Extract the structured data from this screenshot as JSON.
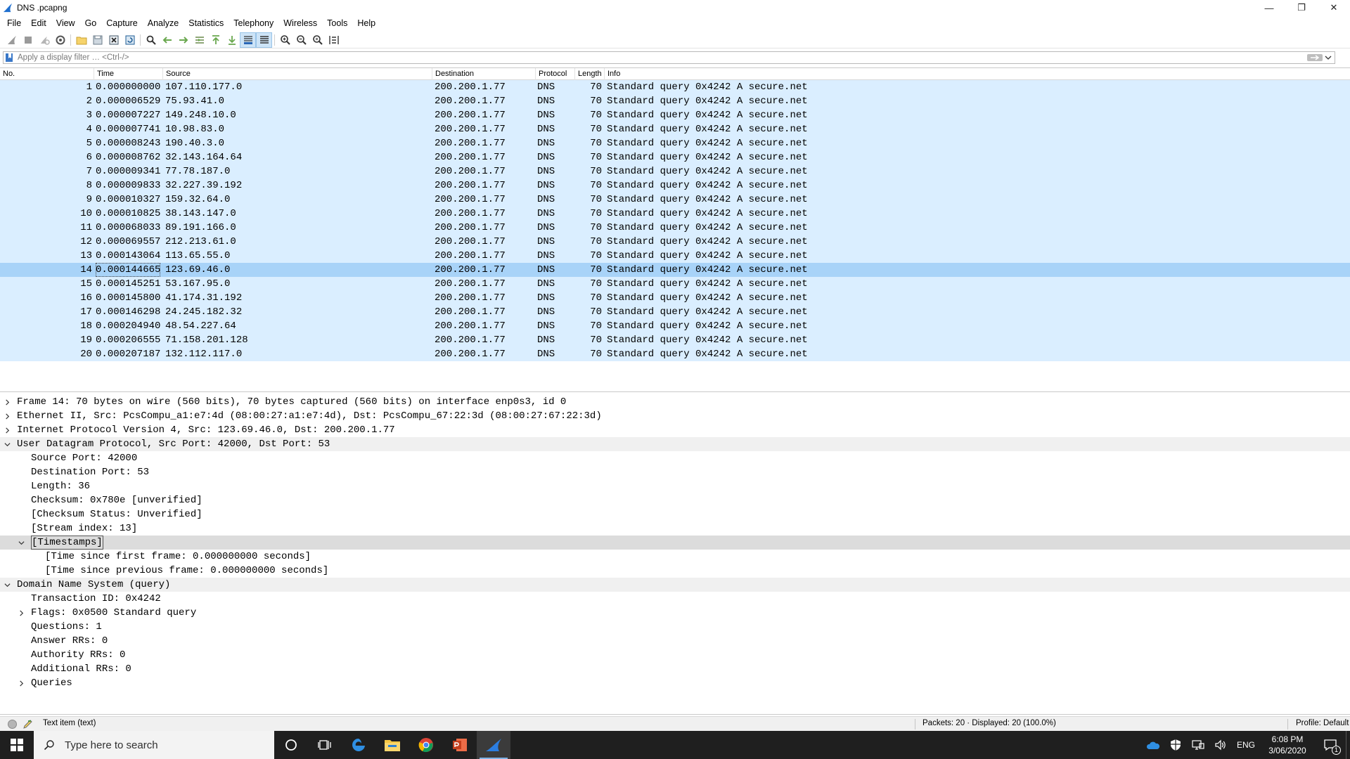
{
  "window": {
    "title": "DNS .pcapng",
    "controls": {
      "minimize": "—",
      "restore": "❐",
      "close": "✕"
    }
  },
  "menu": [
    "File",
    "Edit",
    "View",
    "Go",
    "Capture",
    "Analyze",
    "Statistics",
    "Telephony",
    "Wireless",
    "Tools",
    "Help"
  ],
  "filter": {
    "placeholder": "Apply a display filter … <Ctrl-/>",
    "add_label": "+"
  },
  "packet_list": {
    "columns": [
      "No.",
      "Time",
      "Source",
      "Destination",
      "Protocol",
      "Length",
      "Info"
    ],
    "selected_no": "14",
    "rows": [
      {
        "no": "1",
        "time": "0.000000000",
        "src": "107.110.177.0",
        "dst": "200.200.1.77",
        "proto": "DNS",
        "len": "70",
        "info": "Standard query 0x4242 A secure.net"
      },
      {
        "no": "2",
        "time": "0.000006529",
        "src": "75.93.41.0",
        "dst": "200.200.1.77",
        "proto": "DNS",
        "len": "70",
        "info": "Standard query 0x4242 A secure.net"
      },
      {
        "no": "3",
        "time": "0.000007227",
        "src": "149.248.10.0",
        "dst": "200.200.1.77",
        "proto": "DNS",
        "len": "70",
        "info": "Standard query 0x4242 A secure.net"
      },
      {
        "no": "4",
        "time": "0.000007741",
        "src": "10.98.83.0",
        "dst": "200.200.1.77",
        "proto": "DNS",
        "len": "70",
        "info": "Standard query 0x4242 A secure.net"
      },
      {
        "no": "5",
        "time": "0.000008243",
        "src": "190.40.3.0",
        "dst": "200.200.1.77",
        "proto": "DNS",
        "len": "70",
        "info": "Standard query 0x4242 A secure.net"
      },
      {
        "no": "6",
        "time": "0.000008762",
        "src": "32.143.164.64",
        "dst": "200.200.1.77",
        "proto": "DNS",
        "len": "70",
        "info": "Standard query 0x4242 A secure.net"
      },
      {
        "no": "7",
        "time": "0.000009341",
        "src": "77.78.187.0",
        "dst": "200.200.1.77",
        "proto": "DNS",
        "len": "70",
        "info": "Standard query 0x4242 A secure.net"
      },
      {
        "no": "8",
        "time": "0.000009833",
        "src": "32.227.39.192",
        "dst": "200.200.1.77",
        "proto": "DNS",
        "len": "70",
        "info": "Standard query 0x4242 A secure.net"
      },
      {
        "no": "9",
        "time": "0.000010327",
        "src": "159.32.64.0",
        "dst": "200.200.1.77",
        "proto": "DNS",
        "len": "70",
        "info": "Standard query 0x4242 A secure.net"
      },
      {
        "no": "10",
        "time": "0.000010825",
        "src": "38.143.147.0",
        "dst": "200.200.1.77",
        "proto": "DNS",
        "len": "70",
        "info": "Standard query 0x4242 A secure.net"
      },
      {
        "no": "11",
        "time": "0.000068033",
        "src": "89.191.166.0",
        "dst": "200.200.1.77",
        "proto": "DNS",
        "len": "70",
        "info": "Standard query 0x4242 A secure.net"
      },
      {
        "no": "12",
        "time": "0.000069557",
        "src": "212.213.61.0",
        "dst": "200.200.1.77",
        "proto": "DNS",
        "len": "70",
        "info": "Standard query 0x4242 A secure.net"
      },
      {
        "no": "13",
        "time": "0.000143064",
        "src": "113.65.55.0",
        "dst": "200.200.1.77",
        "proto": "DNS",
        "len": "70",
        "info": "Standard query 0x4242 A secure.net"
      },
      {
        "no": "14",
        "time": "0.000144665",
        "src": "123.69.46.0",
        "dst": "200.200.1.77",
        "proto": "DNS",
        "len": "70",
        "info": "Standard query 0x4242 A secure.net"
      },
      {
        "no": "15",
        "time": "0.000145251",
        "src": "53.167.95.0",
        "dst": "200.200.1.77",
        "proto": "DNS",
        "len": "70",
        "info": "Standard query 0x4242 A secure.net"
      },
      {
        "no": "16",
        "time": "0.000145800",
        "src": "41.174.31.192",
        "dst": "200.200.1.77",
        "proto": "DNS",
        "len": "70",
        "info": "Standard query 0x4242 A secure.net"
      },
      {
        "no": "17",
        "time": "0.000146298",
        "src": "24.245.182.32",
        "dst": "200.200.1.77",
        "proto": "DNS",
        "len": "70",
        "info": "Standard query 0x4242 A secure.net"
      },
      {
        "no": "18",
        "time": "0.000204940",
        "src": "48.54.227.64",
        "dst": "200.200.1.77",
        "proto": "DNS",
        "len": "70",
        "info": "Standard query 0x4242 A secure.net"
      },
      {
        "no": "19",
        "time": "0.000206555",
        "src": "71.158.201.128",
        "dst": "200.200.1.77",
        "proto": "DNS",
        "len": "70",
        "info": "Standard query 0x4242 A secure.net"
      },
      {
        "no": "20",
        "time": "0.000207187",
        "src": "132.112.117.0",
        "dst": "200.200.1.77",
        "proto": "DNS",
        "len": "70",
        "info": "Standard query 0x4242 A secure.net"
      }
    ]
  },
  "details": [
    {
      "level": 0,
      "toggle": "collapsed",
      "text": "Frame 14: 70 bytes on wire (560 bits), 70 bytes captured (560 bits) on interface enp0s3, id 0"
    },
    {
      "level": 0,
      "toggle": "collapsed",
      "text": "Ethernet II, Src: PcsCompu_a1:e7:4d (08:00:27:a1:e7:4d), Dst: PcsCompu_67:22:3d (08:00:27:67:22:3d)"
    },
    {
      "level": 0,
      "toggle": "collapsed",
      "text": "Internet Protocol Version 4, Src: 123.69.46.0, Dst: 200.200.1.77"
    },
    {
      "level": 0,
      "toggle": "expanded",
      "text": "User Datagram Protocol, Src Port: 42000, Dst Port: 53",
      "style": "expanded"
    },
    {
      "level": 1,
      "toggle": "none",
      "text": "Source Port: 42000"
    },
    {
      "level": 1,
      "toggle": "none",
      "text": "Destination Port: 53"
    },
    {
      "level": 1,
      "toggle": "none",
      "text": "Length: 36"
    },
    {
      "level": 1,
      "toggle": "none",
      "text": "Checksum: 0x780e [unverified]"
    },
    {
      "level": 1,
      "toggle": "none",
      "text": "[Checksum Status: Unverified]"
    },
    {
      "level": 1,
      "toggle": "none",
      "text": "[Stream index: 13]"
    },
    {
      "level": 1,
      "toggle": "expanded",
      "text": "[Timestamps]",
      "style": "highlight"
    },
    {
      "level": 2,
      "toggle": "none",
      "text": "[Time since first frame: 0.000000000 seconds]"
    },
    {
      "level": 2,
      "toggle": "none",
      "text": "[Time since previous frame: 0.000000000 seconds]"
    },
    {
      "level": 0,
      "toggle": "expanded",
      "text": "Domain Name System (query)",
      "style": "expanded"
    },
    {
      "level": 1,
      "toggle": "none",
      "text": "Transaction ID: 0x4242"
    },
    {
      "level": 1,
      "toggle": "collapsed",
      "text": "Flags: 0x0500 Standard query"
    },
    {
      "level": 1,
      "toggle": "none",
      "text": "Questions: 1"
    },
    {
      "level": 1,
      "toggle": "none",
      "text": "Answer RRs: 0"
    },
    {
      "level": 1,
      "toggle": "none",
      "text": "Authority RRs: 0"
    },
    {
      "level": 1,
      "toggle": "none",
      "text": "Additional RRs: 0"
    },
    {
      "level": 1,
      "toggle": "collapsed",
      "text": "Queries"
    }
  ],
  "status": {
    "field_text": "Text item (text)",
    "packets": "Packets: 20 · Displayed: 20 (100.0%)",
    "profile": "Profile: Default"
  },
  "taskbar": {
    "search_placeholder": "Type here to search",
    "lang": "ENG",
    "time": "6:08 PM",
    "date": "3/06/2020",
    "notification_count": "1"
  },
  "colors": {
    "row_bg": "#daeeff",
    "row_selected": "#a8d3f8",
    "taskbar": "#1f1f1f",
    "accent": "#1f6fcf"
  }
}
